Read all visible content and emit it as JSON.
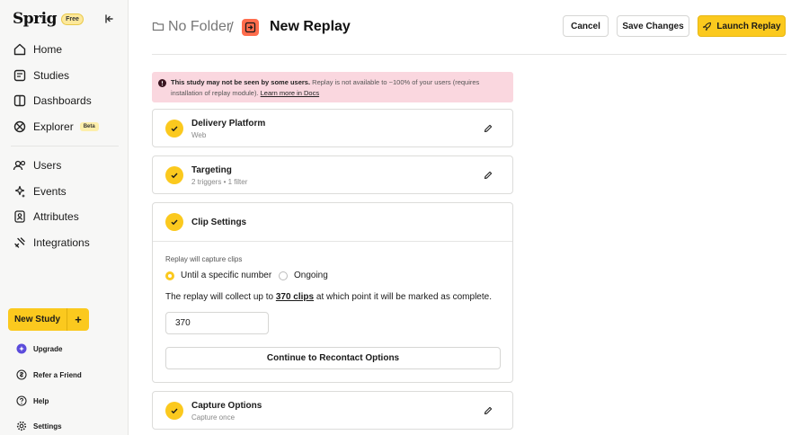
{
  "sidebar": {
    "logo": "Sprig",
    "plan_badge": "Free",
    "nav_primary": [
      {
        "label": "Home",
        "icon": "home-icon"
      },
      {
        "label": "Studies",
        "icon": "studies-icon"
      },
      {
        "label": "Dashboards",
        "icon": "dashboards-icon"
      },
      {
        "label": "Explorer",
        "icon": "explorer-icon",
        "badge": "Beta"
      }
    ],
    "nav_secondary": [
      {
        "label": "Users",
        "icon": "users-icon"
      },
      {
        "label": "Events",
        "icon": "events-icon"
      },
      {
        "label": "Attributes",
        "icon": "attributes-icon"
      },
      {
        "label": "Integrations",
        "icon": "integrations-icon"
      }
    ],
    "new_study_label": "New Study",
    "new_study_plus": "+",
    "footer": [
      {
        "label": "Upgrade",
        "icon": "upgrade-icon"
      },
      {
        "label": "Refer a Friend",
        "icon": "refer-icon"
      },
      {
        "label": "Help",
        "icon": "help-icon"
      },
      {
        "label": "Settings",
        "icon": "settings-icon"
      }
    ]
  },
  "header": {
    "folder": "No Folder",
    "separator": "/",
    "title": "New Replay",
    "cancel_label": "Cancel",
    "save_label": "Save Changes",
    "launch_label": "Launch Replay"
  },
  "alert": {
    "bold": "This study may not be seen by some users.",
    "text": " Replay is not available to ~100% of your users (requires installation of replay module). ",
    "link": "Learn more in Docs"
  },
  "cards": {
    "delivery": {
      "title": "Delivery Platform",
      "subtitle": "Web"
    },
    "targeting": {
      "title": "Targeting",
      "subtitle": "2 triggers • 1 filter"
    },
    "clip": {
      "title": "Clip Settings",
      "caption": "Replay will capture clips",
      "option_specific": "Until a specific number",
      "option_ongoing": "Ongoing",
      "selected": "specific",
      "collect_prefix": "The replay will collect up to ",
      "collect_count": "370 clips",
      "collect_suffix": " at which point it will be marked as complete.",
      "input_value": "370",
      "continue_label": "Continue to Recontact Options"
    },
    "capture": {
      "title": "Capture Options",
      "subtitle": "Capture once"
    }
  },
  "colors": {
    "accent": "#fbc91e",
    "alert_bg": "#fad7df",
    "replay_icon": "#ff6d4d"
  }
}
